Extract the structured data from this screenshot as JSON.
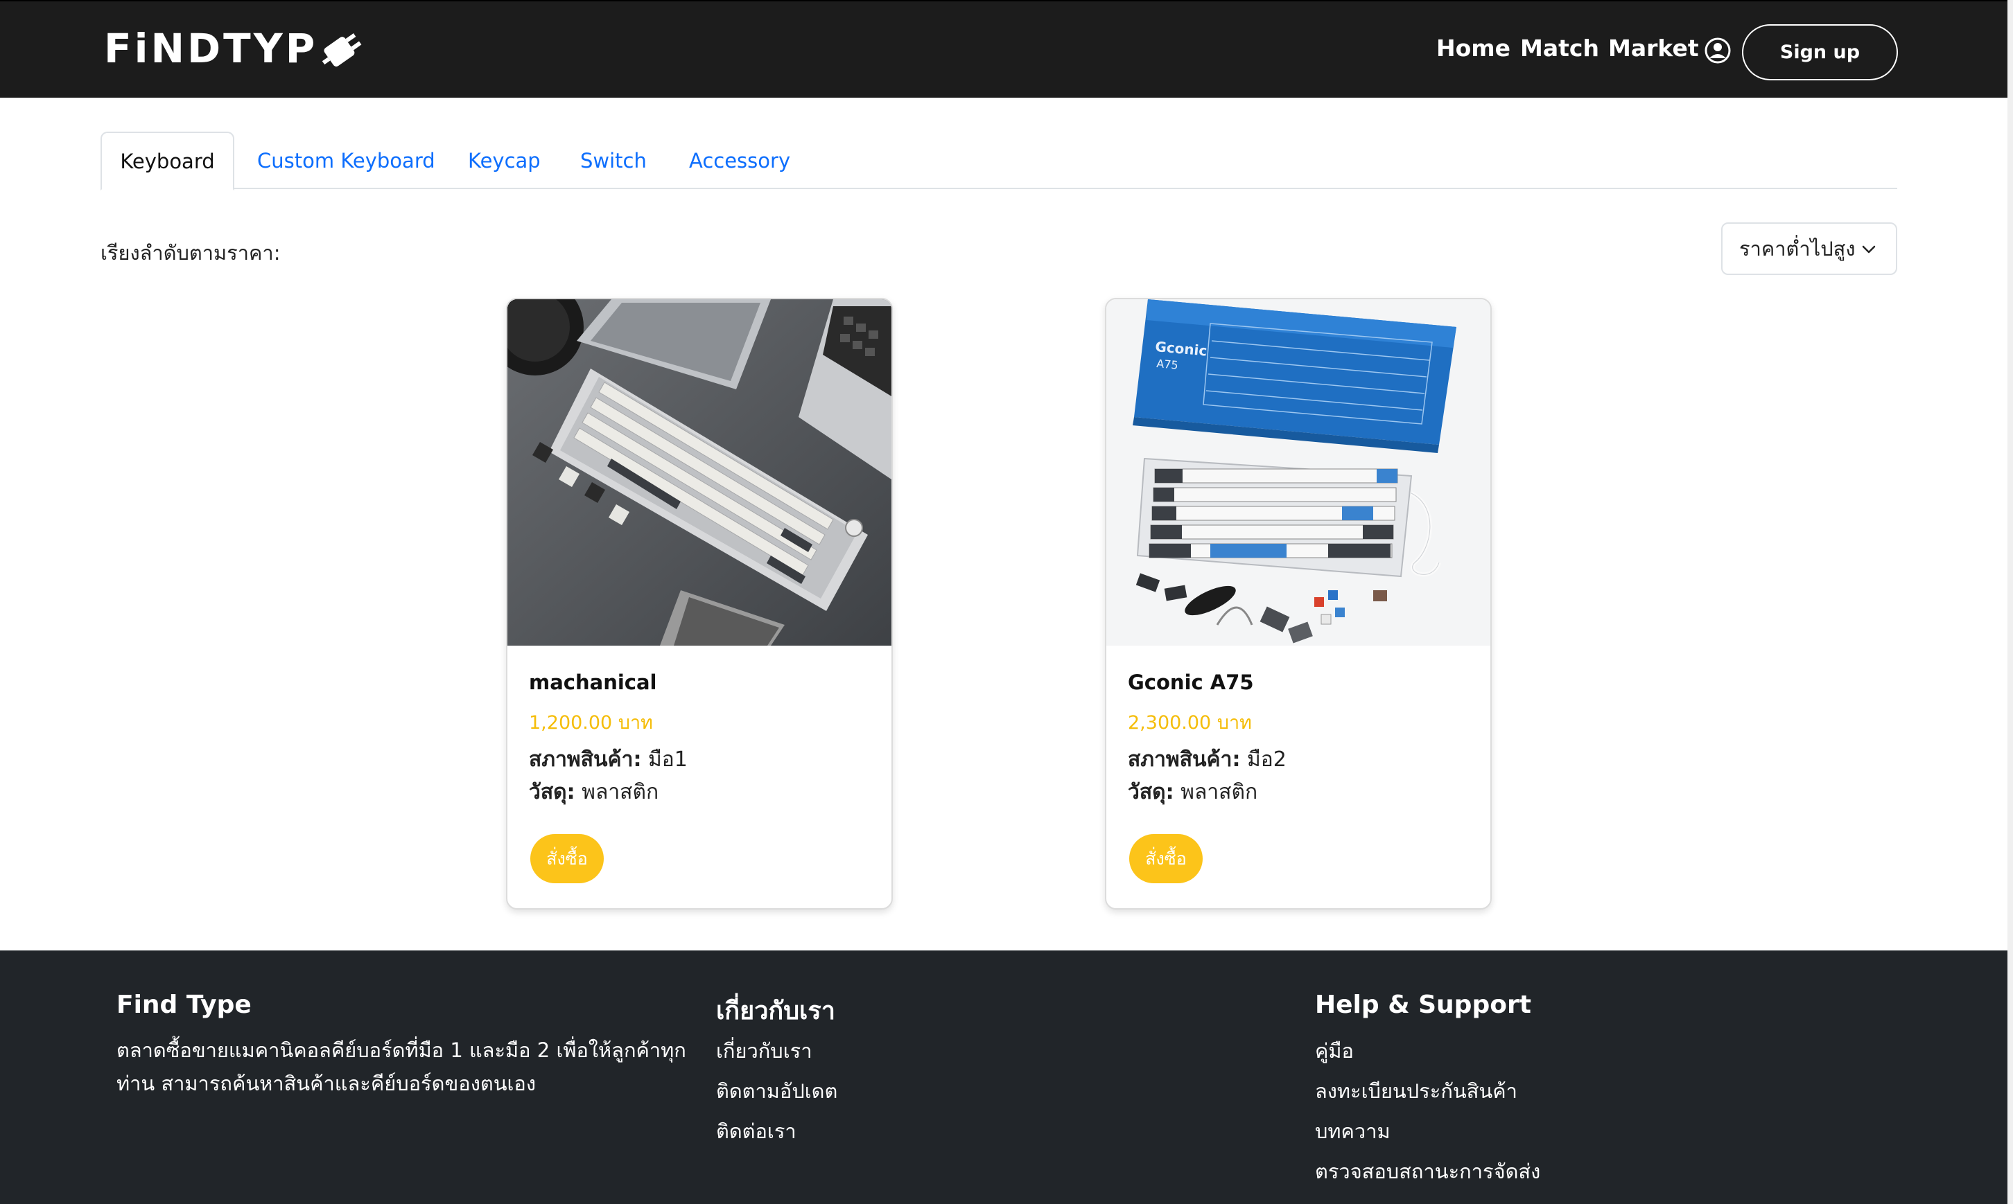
{
  "header": {
    "logo_text": "FiNDTYP",
    "logo_icon": "keyboard-plug-icon",
    "nav": [
      "Home",
      "Match",
      "Market"
    ],
    "user_icon": "user-circle-icon",
    "signup_label": "Sign up"
  },
  "tabs": [
    {
      "label": "Keyboard",
      "active": true
    },
    {
      "label": "Custom Keyboard",
      "active": false
    },
    {
      "label": "Keycap",
      "active": false
    },
    {
      "label": "Switch",
      "active": false
    },
    {
      "label": "Accessory",
      "active": false
    }
  ],
  "sort": {
    "label": "เรียงลำดับตามราคา:",
    "selected": "ราคาต่ำไปสูง",
    "icon": "chevron-down-icon"
  },
  "products": [
    {
      "name": "machanical",
      "price": "1,200.00 บาท",
      "condition_label": "สภาพสินค้า:",
      "condition_value": " มือ1",
      "material_label": "วัสดุ:",
      "material_value": " พลาสติก",
      "button": "สั่งซื้อ"
    },
    {
      "name": "Gconic A75",
      "price": "2,300.00 บาท",
      "condition_label": "สภาพสินค้า:",
      "condition_value": " มือ2",
      "material_label": "วัสดุ:",
      "material_value": " พลาสติก",
      "button": "สั่งซื้อ"
    }
  ],
  "footer": {
    "about": {
      "title": "Find Type",
      "description": "ตลาดซื้อขายแมคานิคอลคีย์บอร์ดที่มือ 1 และมือ 2 เพื่อให้ลูกค้าทุกท่าน สามารถค้นหาสินค้าและคีย์บอร์ดของตนเอง"
    },
    "company": {
      "title": "เกี่ยวกับเรา",
      "links": [
        "เกี่ยวกับเรา",
        "ติดตามอัปเดต",
        "ติดต่อเรา"
      ]
    },
    "support": {
      "title": "Help & Support",
      "links": [
        "คู่มือ",
        "ลงทะเบียนประกันสินค้า",
        "บทความ",
        "ตรวจสอบสถานะการจัดส่ง"
      ]
    }
  },
  "colors": {
    "navbar": "#1c1c1c",
    "footer": "#212529",
    "accent": "#fcc41a",
    "price": "#f5bd0a",
    "tab_link": "#0d6efd"
  }
}
